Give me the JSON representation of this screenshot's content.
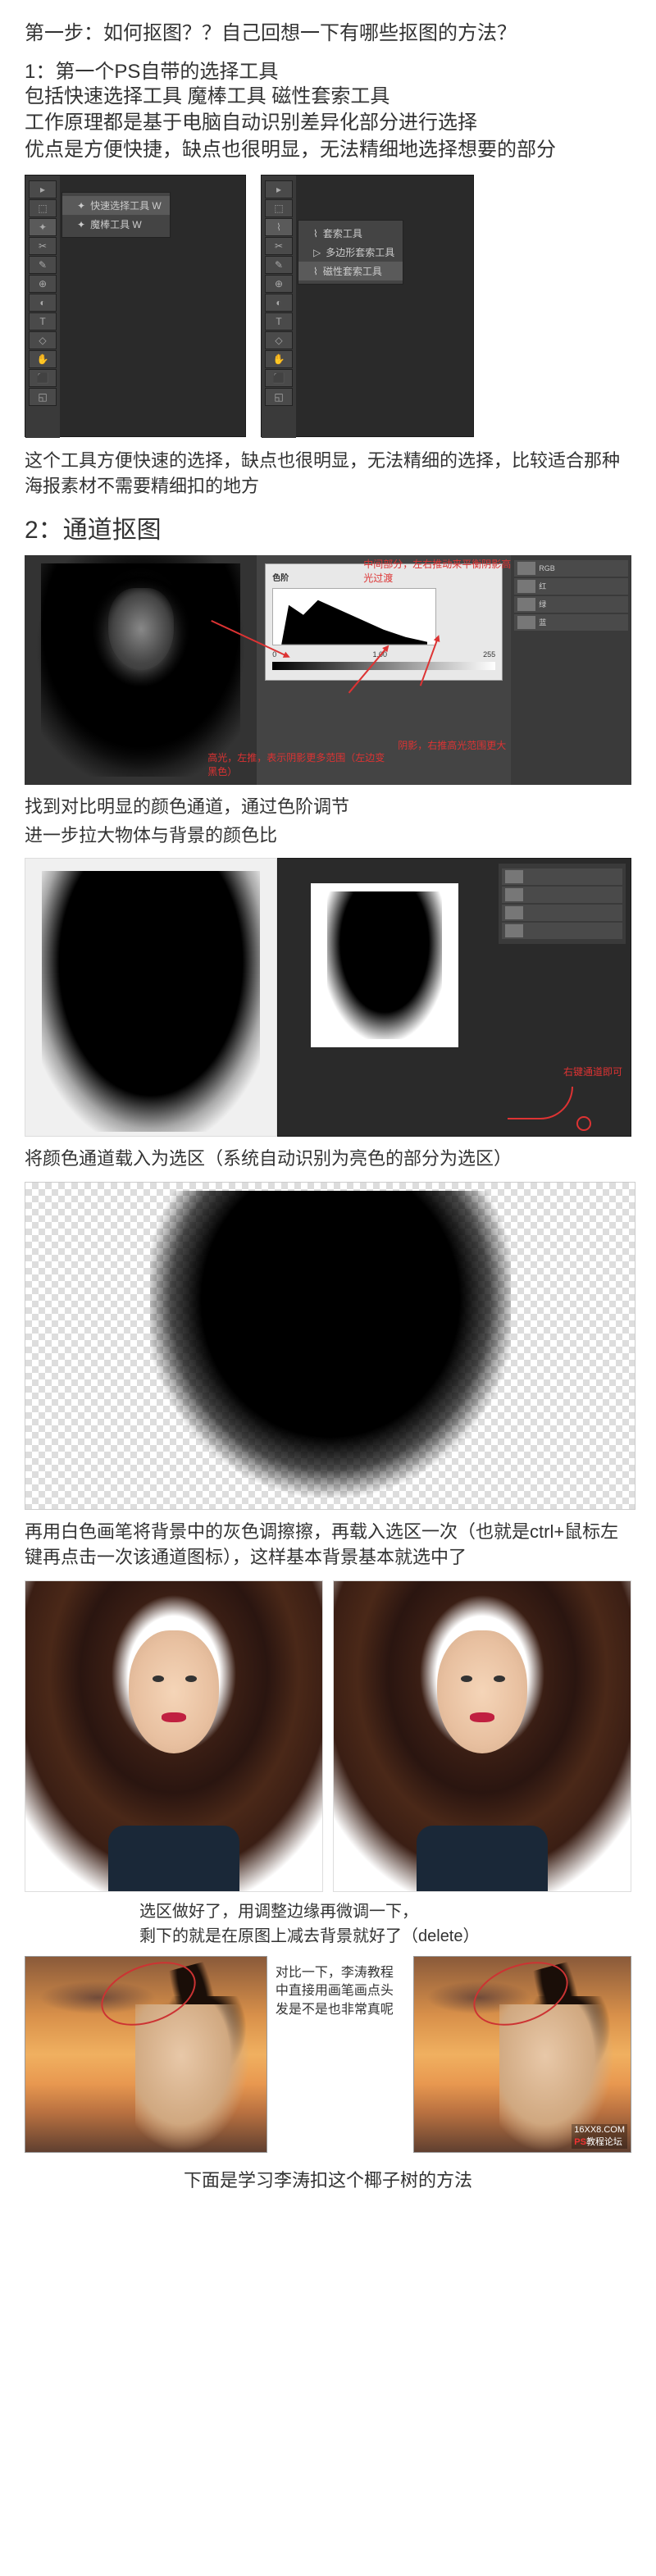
{
  "step1_title": "第一步：如何抠图？？自己回想一下有哪些抠图的方法？",
  "method1": {
    "num": "1：第一个PS自带的选择工具",
    "line1": "包括快速选择工具 魔棒工具 磁性套索工具",
    "line2": "工作原理都是基于电脑自动识别差异化部分进行选择",
    "line3": "优点是方便快捷，缺点也很明显，无法精细地选择想要的部分"
  },
  "toolbar1": {
    "flyout_items": [
      "快速选择工具  W",
      "魔棒工具        W"
    ]
  },
  "toolbar2": {
    "flyout_items": [
      "套索工具",
      "多边形套索工具",
      "磁性套索工具"
    ]
  },
  "caption_tool": "这个工具方便快速的选择，缺点也很明显，无法精细的选择，比较适合那种海报素材不需要精细扣的地方",
  "method2_header": "2：通道抠图",
  "levels_dialog": {
    "title": "色阶"
  },
  "channel_annot": {
    "top": "中间部分，左右推动来平衡阴影高光过渡",
    "bottom_right": "阴影，右推高光范围更大",
    "bottom_left": "高光，左推，表示阴影更多范围（左边变黑色）"
  },
  "caption_channel1": "找到对比明显的颜色通道，通过色阶调节",
  "caption_channel1b": "进一步拉大物体与背景的颜色比",
  "silhouette_annot": "右键通道即可",
  "caption_channel2": "将颜色通道载入为选区（系统自动识别为亮色的部分为选区）",
  "caption_channel3": "再用白色画笔将背景中的灰色调擦擦，再载入选区一次（也就是ctrl+鼠标左键再点击一次该通道图标），这样基本背景基本就选中了",
  "indent1": "选区做好了，用调整边缘再微调一下，",
  "indent2": "剩下的就是在原图上减去背景就好了（delete）",
  "compare_text": "对比一下，李涛教程中直接用画笔画点头发是不是也非常真呢",
  "watermark": {
    "site": "16XX8.COM",
    "brand_red": "PS",
    "brand_rest": "教程论坛"
  },
  "bottom_text": "下面是学习李涛扣这个椰子树的方法"
}
